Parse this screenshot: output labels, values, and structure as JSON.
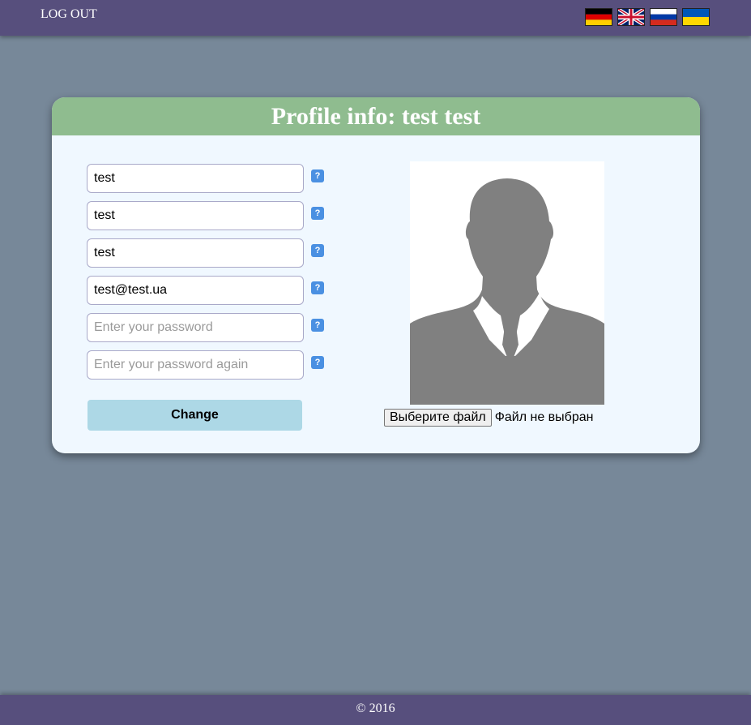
{
  "header": {
    "logout_label": "LOG OUT",
    "languages": [
      {
        "code": "de",
        "icon": "germany-flag-icon"
      },
      {
        "code": "en",
        "icon": "uk-flag-icon"
      },
      {
        "code": "ru",
        "icon": "russia-flag-icon"
      },
      {
        "code": "ua",
        "icon": "ukraine-flag-icon"
      }
    ]
  },
  "profile": {
    "title": "Profile info: test test",
    "fields": [
      {
        "name": "first-name",
        "value": "test",
        "placeholder": ""
      },
      {
        "name": "last-name",
        "value": "test",
        "placeholder": ""
      },
      {
        "name": "login",
        "value": "test",
        "placeholder": ""
      },
      {
        "name": "email",
        "value": "test@test.ua",
        "placeholder": ""
      },
      {
        "name": "password",
        "value": "",
        "placeholder": "Enter your password"
      },
      {
        "name": "password-repeat",
        "value": "",
        "placeholder": "Enter your password again"
      }
    ],
    "help_label": "?",
    "change_label": "Change",
    "avatar_icon": "person-silhouette-icon",
    "file_button_label": "Выберите файл",
    "file_status": "Файл не выбран"
  },
  "footer": {
    "copyright": "© 2016"
  },
  "colors": {
    "topbar": "#574f7d",
    "background": "#778899",
    "card_header": "#8fbc8f",
    "card_body": "#f0f8ff",
    "change_button": "#add8e6",
    "help_icon": "#4a90e2"
  }
}
